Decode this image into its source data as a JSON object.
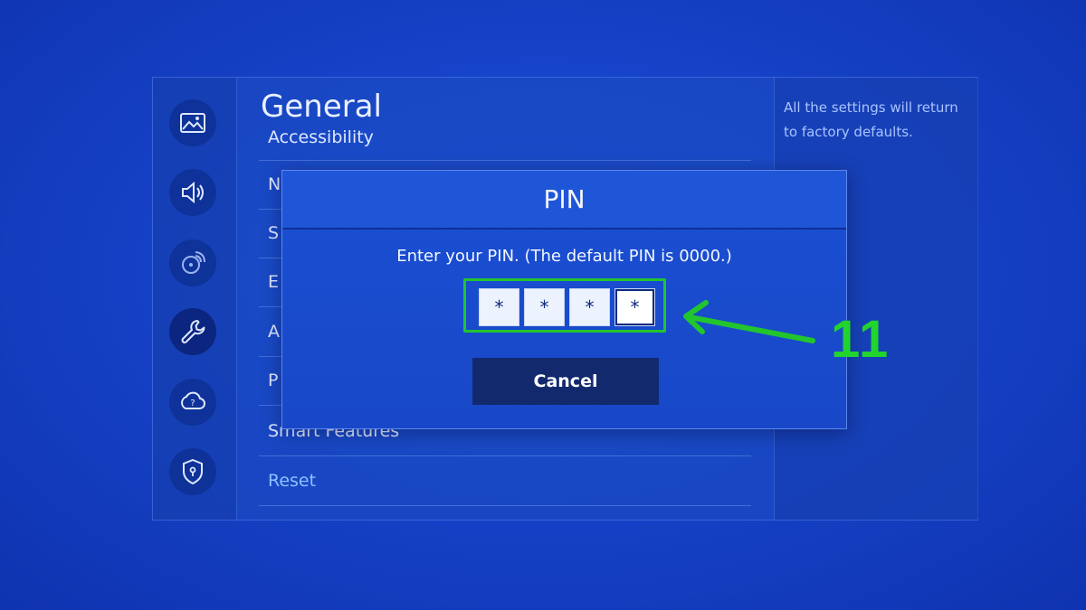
{
  "screen": {
    "title": "General",
    "info_text": "All the settings will return to factory defaults.",
    "sidebar": {
      "icons": [
        {
          "name": "picture-icon",
          "active": false
        },
        {
          "name": "sound-icon",
          "active": false
        },
        {
          "name": "broadcasting-icon",
          "active": false
        },
        {
          "name": "general-wrench-icon",
          "active": true
        },
        {
          "name": "support-icon",
          "active": false
        },
        {
          "name": "privacy-shield-icon",
          "active": false
        }
      ]
    },
    "menu": {
      "items": [
        {
          "label": "Accessibility"
        },
        {
          "label": "N"
        },
        {
          "label": "S"
        },
        {
          "label": "E"
        },
        {
          "label": "A"
        },
        {
          "label": "P"
        },
        {
          "label": "Smart Features"
        },
        {
          "label": "Reset",
          "highlighted": true
        }
      ]
    }
  },
  "dialog": {
    "title": "PIN",
    "prompt": "Enter your PIN. (The default PIN is 0000.)",
    "pin_digits": [
      "*",
      "*",
      "*",
      "*"
    ],
    "cancel_label": "Cancel"
  },
  "annotation": {
    "number": "11",
    "color": "#22c52e"
  },
  "colors": {
    "background": "#1643c9",
    "dialog_background": "#1a4fd2",
    "button_background": "#13296e",
    "highlight_text": "#8fc0ff"
  }
}
